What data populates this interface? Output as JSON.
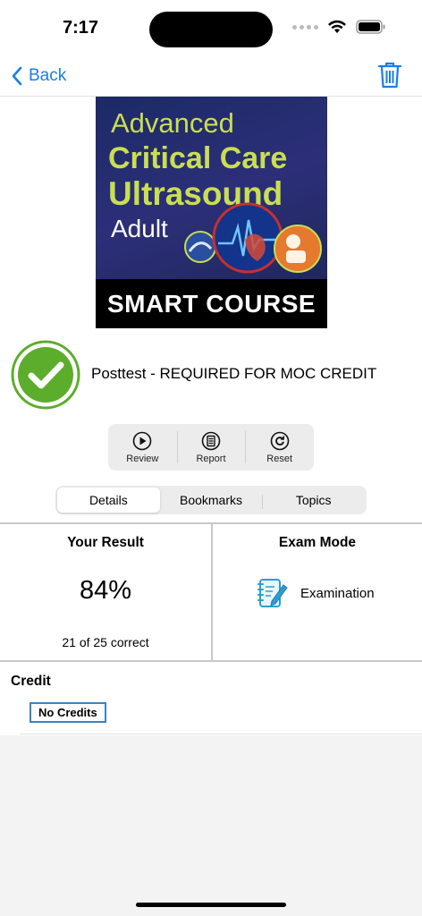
{
  "status_bar": {
    "time": "7:17"
  },
  "nav": {
    "back_label": "Back"
  },
  "cover": {
    "line1": "Advanced",
    "line2": "Critical Care",
    "line3": "Ultrasound",
    "line4": "Adult",
    "banner": "SMART COURSE"
  },
  "exam": {
    "title": "Posttest - REQUIRED FOR MOC CREDIT"
  },
  "actions": [
    {
      "label": "Review",
      "icon": "play-icon"
    },
    {
      "label": "Report",
      "icon": "report-icon"
    },
    {
      "label": "Reset",
      "icon": "reset-icon"
    }
  ],
  "tabs": [
    {
      "label": "Details",
      "active": true
    },
    {
      "label": "Bookmarks",
      "active": false
    },
    {
      "label": "Topics",
      "active": false
    }
  ],
  "result": {
    "title": "Your Result",
    "score": "84%",
    "correct": "21 of 25 correct"
  },
  "mode": {
    "title": "Exam Mode",
    "value": "Examination"
  },
  "credit": {
    "title": "Credit",
    "badge": "No Credits"
  },
  "colors": {
    "accent": "#1a7ee5",
    "check_green": "#5cad2b",
    "cover_text": "#c9de52"
  }
}
